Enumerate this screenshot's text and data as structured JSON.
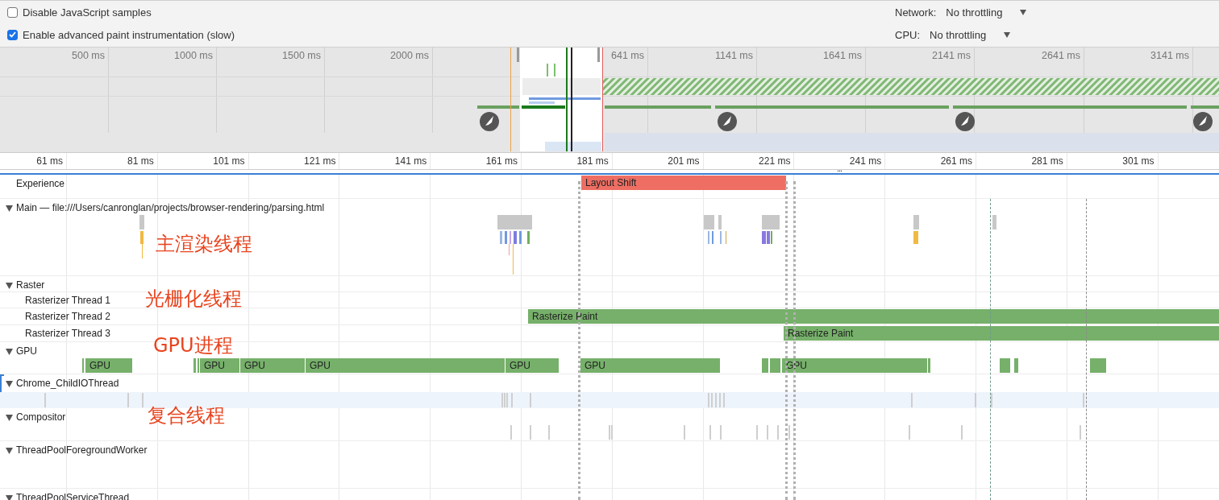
{
  "settings": {
    "checkboxes": [
      {
        "label": "Disable JavaScript samples",
        "checked": false
      },
      {
        "label": "Enable advanced paint instrumentation (slow)",
        "checked": true
      }
    ],
    "throttling": [
      {
        "label": "Network:",
        "value": "No throttling"
      },
      {
        "label": "CPU:",
        "value": "No throttling"
      }
    ]
  },
  "overview": {
    "ticks": [
      "500 ms",
      "1000 ms",
      "1500 ms",
      "2000 ms",
      "641 ms",
      "1141 ms",
      "1641 ms",
      "2141 ms",
      "2641 ms",
      "3141 ms"
    ]
  },
  "ruler": {
    "ticks": [
      "61 ms",
      "81 ms",
      "101 ms",
      "121 ms",
      "141 ms",
      "161 ms",
      "181 ms",
      "201 ms",
      "221 ms",
      "241 ms",
      "261 ms",
      "281 ms",
      "301 ms"
    ],
    "grip": "..."
  },
  "tracks": [
    {
      "kind": "lane",
      "name": "Experience",
      "selected": false,
      "events": [
        {
          "label": "Layout Shift",
          "color": "#ee6e63"
        }
      ]
    },
    {
      "kind": "group",
      "name": "Main — file:///Users/canronglan/projects/browser-rendering/parsing.html",
      "expanded": true,
      "selected": false
    },
    {
      "kind": "group",
      "name": "Raster",
      "expanded": true,
      "selected": false,
      "children": [
        {
          "kind": "lane",
          "name": "Rasterizer Thread 1"
        },
        {
          "kind": "lane",
          "name": "Rasterizer Thread 2",
          "events": [
            {
              "label": "Rasterize Paint",
              "color": "#76b06a"
            }
          ]
        },
        {
          "kind": "lane",
          "name": "Rasterizer Thread 3",
          "events": [
            {
              "label": "Rasterize Paint",
              "color": "#76b06a"
            }
          ]
        }
      ]
    },
    {
      "kind": "group",
      "name": "GPU",
      "expanded": true,
      "selected": false,
      "events": [
        {
          "label": "GPU",
          "color": "#76b06a"
        },
        {
          "label": "GPU",
          "color": "#76b06a"
        },
        {
          "label": "GPU",
          "color": "#76b06a"
        },
        {
          "label": "GPU",
          "color": "#76b06a"
        },
        {
          "label": "GPU",
          "color": "#76b06a"
        },
        {
          "label": "GPU",
          "color": "#76b06a"
        },
        {
          "label": "GPU",
          "color": "#76b06a"
        }
      ]
    },
    {
      "kind": "group",
      "name": "Chrome_ChildIOThread",
      "expanded": true,
      "selected": true
    },
    {
      "kind": "group",
      "name": "Compositor",
      "expanded": true,
      "selected": false
    },
    {
      "kind": "group",
      "name": "ThreadPoolForegroundWorker",
      "expanded": true,
      "selected": false
    },
    {
      "kind": "group",
      "name": "ThreadPoolServiceThread",
      "expanded": true,
      "selected": false
    }
  ],
  "annotations": [
    "主渲染线程",
    "光栅化线程",
    "GPU进程",
    "复合线程"
  ]
}
